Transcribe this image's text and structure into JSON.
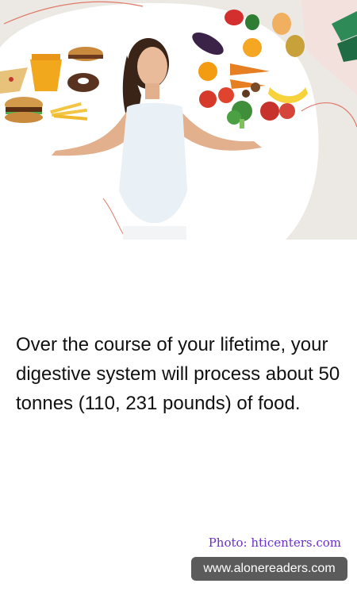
{
  "hero": {
    "image_subject": "woman shrugging between fast food and fruits and vegetables",
    "left_group": [
      "burger-icon",
      "fries-icon",
      "donut-icon",
      "pizza-icon",
      "takeout-box-icon"
    ],
    "right_group": [
      "pepper-icon",
      "eggplant-icon",
      "orange-icon",
      "carrot-icon",
      "tomato-icon",
      "broccoli-icon",
      "apple-icon",
      "banana-icon",
      "pear-icon"
    ],
    "logo": "brand-logo-icon",
    "colors": {
      "background": "#ece9e4",
      "blob": "#ffffff",
      "accent_line": "#e07a6a",
      "logo_green": "#2e8b57"
    }
  },
  "fact": {
    "text": "Over the course of your lifetime, your digestive system will process about 50 tonnes (110, 231 pounds) of food."
  },
  "credit": {
    "text": "Photo: hticenters.com",
    "color": "#6a2fd0"
  },
  "site": {
    "url": "www.alonereaders.com",
    "badge_color": "#5b5b5b"
  }
}
